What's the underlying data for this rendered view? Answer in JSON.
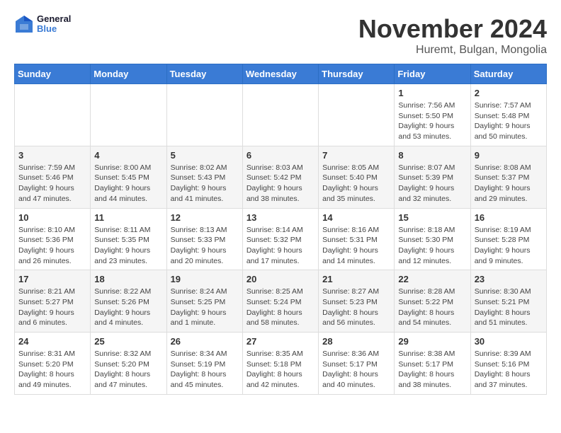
{
  "header": {
    "logo_line1": "General",
    "logo_line2": "Blue",
    "month": "November 2024",
    "location": "Huremt, Bulgan, Mongolia"
  },
  "weekdays": [
    "Sunday",
    "Monday",
    "Tuesday",
    "Wednesday",
    "Thursday",
    "Friday",
    "Saturday"
  ],
  "weeks": [
    [
      {
        "day": "",
        "info": ""
      },
      {
        "day": "",
        "info": ""
      },
      {
        "day": "",
        "info": ""
      },
      {
        "day": "",
        "info": ""
      },
      {
        "day": "",
        "info": ""
      },
      {
        "day": "1",
        "info": "Sunrise: 7:56 AM\nSunset: 5:50 PM\nDaylight: 9 hours and 53 minutes."
      },
      {
        "day": "2",
        "info": "Sunrise: 7:57 AM\nSunset: 5:48 PM\nDaylight: 9 hours and 50 minutes."
      }
    ],
    [
      {
        "day": "3",
        "info": "Sunrise: 7:59 AM\nSunset: 5:46 PM\nDaylight: 9 hours and 47 minutes."
      },
      {
        "day": "4",
        "info": "Sunrise: 8:00 AM\nSunset: 5:45 PM\nDaylight: 9 hours and 44 minutes."
      },
      {
        "day": "5",
        "info": "Sunrise: 8:02 AM\nSunset: 5:43 PM\nDaylight: 9 hours and 41 minutes."
      },
      {
        "day": "6",
        "info": "Sunrise: 8:03 AM\nSunset: 5:42 PM\nDaylight: 9 hours and 38 minutes."
      },
      {
        "day": "7",
        "info": "Sunrise: 8:05 AM\nSunset: 5:40 PM\nDaylight: 9 hours and 35 minutes."
      },
      {
        "day": "8",
        "info": "Sunrise: 8:07 AM\nSunset: 5:39 PM\nDaylight: 9 hours and 32 minutes."
      },
      {
        "day": "9",
        "info": "Sunrise: 8:08 AM\nSunset: 5:37 PM\nDaylight: 9 hours and 29 minutes."
      }
    ],
    [
      {
        "day": "10",
        "info": "Sunrise: 8:10 AM\nSunset: 5:36 PM\nDaylight: 9 hours and 26 minutes."
      },
      {
        "day": "11",
        "info": "Sunrise: 8:11 AM\nSunset: 5:35 PM\nDaylight: 9 hours and 23 minutes."
      },
      {
        "day": "12",
        "info": "Sunrise: 8:13 AM\nSunset: 5:33 PM\nDaylight: 9 hours and 20 minutes."
      },
      {
        "day": "13",
        "info": "Sunrise: 8:14 AM\nSunset: 5:32 PM\nDaylight: 9 hours and 17 minutes."
      },
      {
        "day": "14",
        "info": "Sunrise: 8:16 AM\nSunset: 5:31 PM\nDaylight: 9 hours and 14 minutes."
      },
      {
        "day": "15",
        "info": "Sunrise: 8:18 AM\nSunset: 5:30 PM\nDaylight: 9 hours and 12 minutes."
      },
      {
        "day": "16",
        "info": "Sunrise: 8:19 AM\nSunset: 5:28 PM\nDaylight: 9 hours and 9 minutes."
      }
    ],
    [
      {
        "day": "17",
        "info": "Sunrise: 8:21 AM\nSunset: 5:27 PM\nDaylight: 9 hours and 6 minutes."
      },
      {
        "day": "18",
        "info": "Sunrise: 8:22 AM\nSunset: 5:26 PM\nDaylight: 9 hours and 4 minutes."
      },
      {
        "day": "19",
        "info": "Sunrise: 8:24 AM\nSunset: 5:25 PM\nDaylight: 9 hours and 1 minute."
      },
      {
        "day": "20",
        "info": "Sunrise: 8:25 AM\nSunset: 5:24 PM\nDaylight: 8 hours and 58 minutes."
      },
      {
        "day": "21",
        "info": "Sunrise: 8:27 AM\nSunset: 5:23 PM\nDaylight: 8 hours and 56 minutes."
      },
      {
        "day": "22",
        "info": "Sunrise: 8:28 AM\nSunset: 5:22 PM\nDaylight: 8 hours and 54 minutes."
      },
      {
        "day": "23",
        "info": "Sunrise: 8:30 AM\nSunset: 5:21 PM\nDaylight: 8 hours and 51 minutes."
      }
    ],
    [
      {
        "day": "24",
        "info": "Sunrise: 8:31 AM\nSunset: 5:20 PM\nDaylight: 8 hours and 49 minutes."
      },
      {
        "day": "25",
        "info": "Sunrise: 8:32 AM\nSunset: 5:20 PM\nDaylight: 8 hours and 47 minutes."
      },
      {
        "day": "26",
        "info": "Sunrise: 8:34 AM\nSunset: 5:19 PM\nDaylight: 8 hours and 45 minutes."
      },
      {
        "day": "27",
        "info": "Sunrise: 8:35 AM\nSunset: 5:18 PM\nDaylight: 8 hours and 42 minutes."
      },
      {
        "day": "28",
        "info": "Sunrise: 8:36 AM\nSunset: 5:17 PM\nDaylight: 8 hours and 40 minutes."
      },
      {
        "day": "29",
        "info": "Sunrise: 8:38 AM\nSunset: 5:17 PM\nDaylight: 8 hours and 38 minutes."
      },
      {
        "day": "30",
        "info": "Sunrise: 8:39 AM\nSunset: 5:16 PM\nDaylight: 8 hours and 37 minutes."
      }
    ]
  ]
}
